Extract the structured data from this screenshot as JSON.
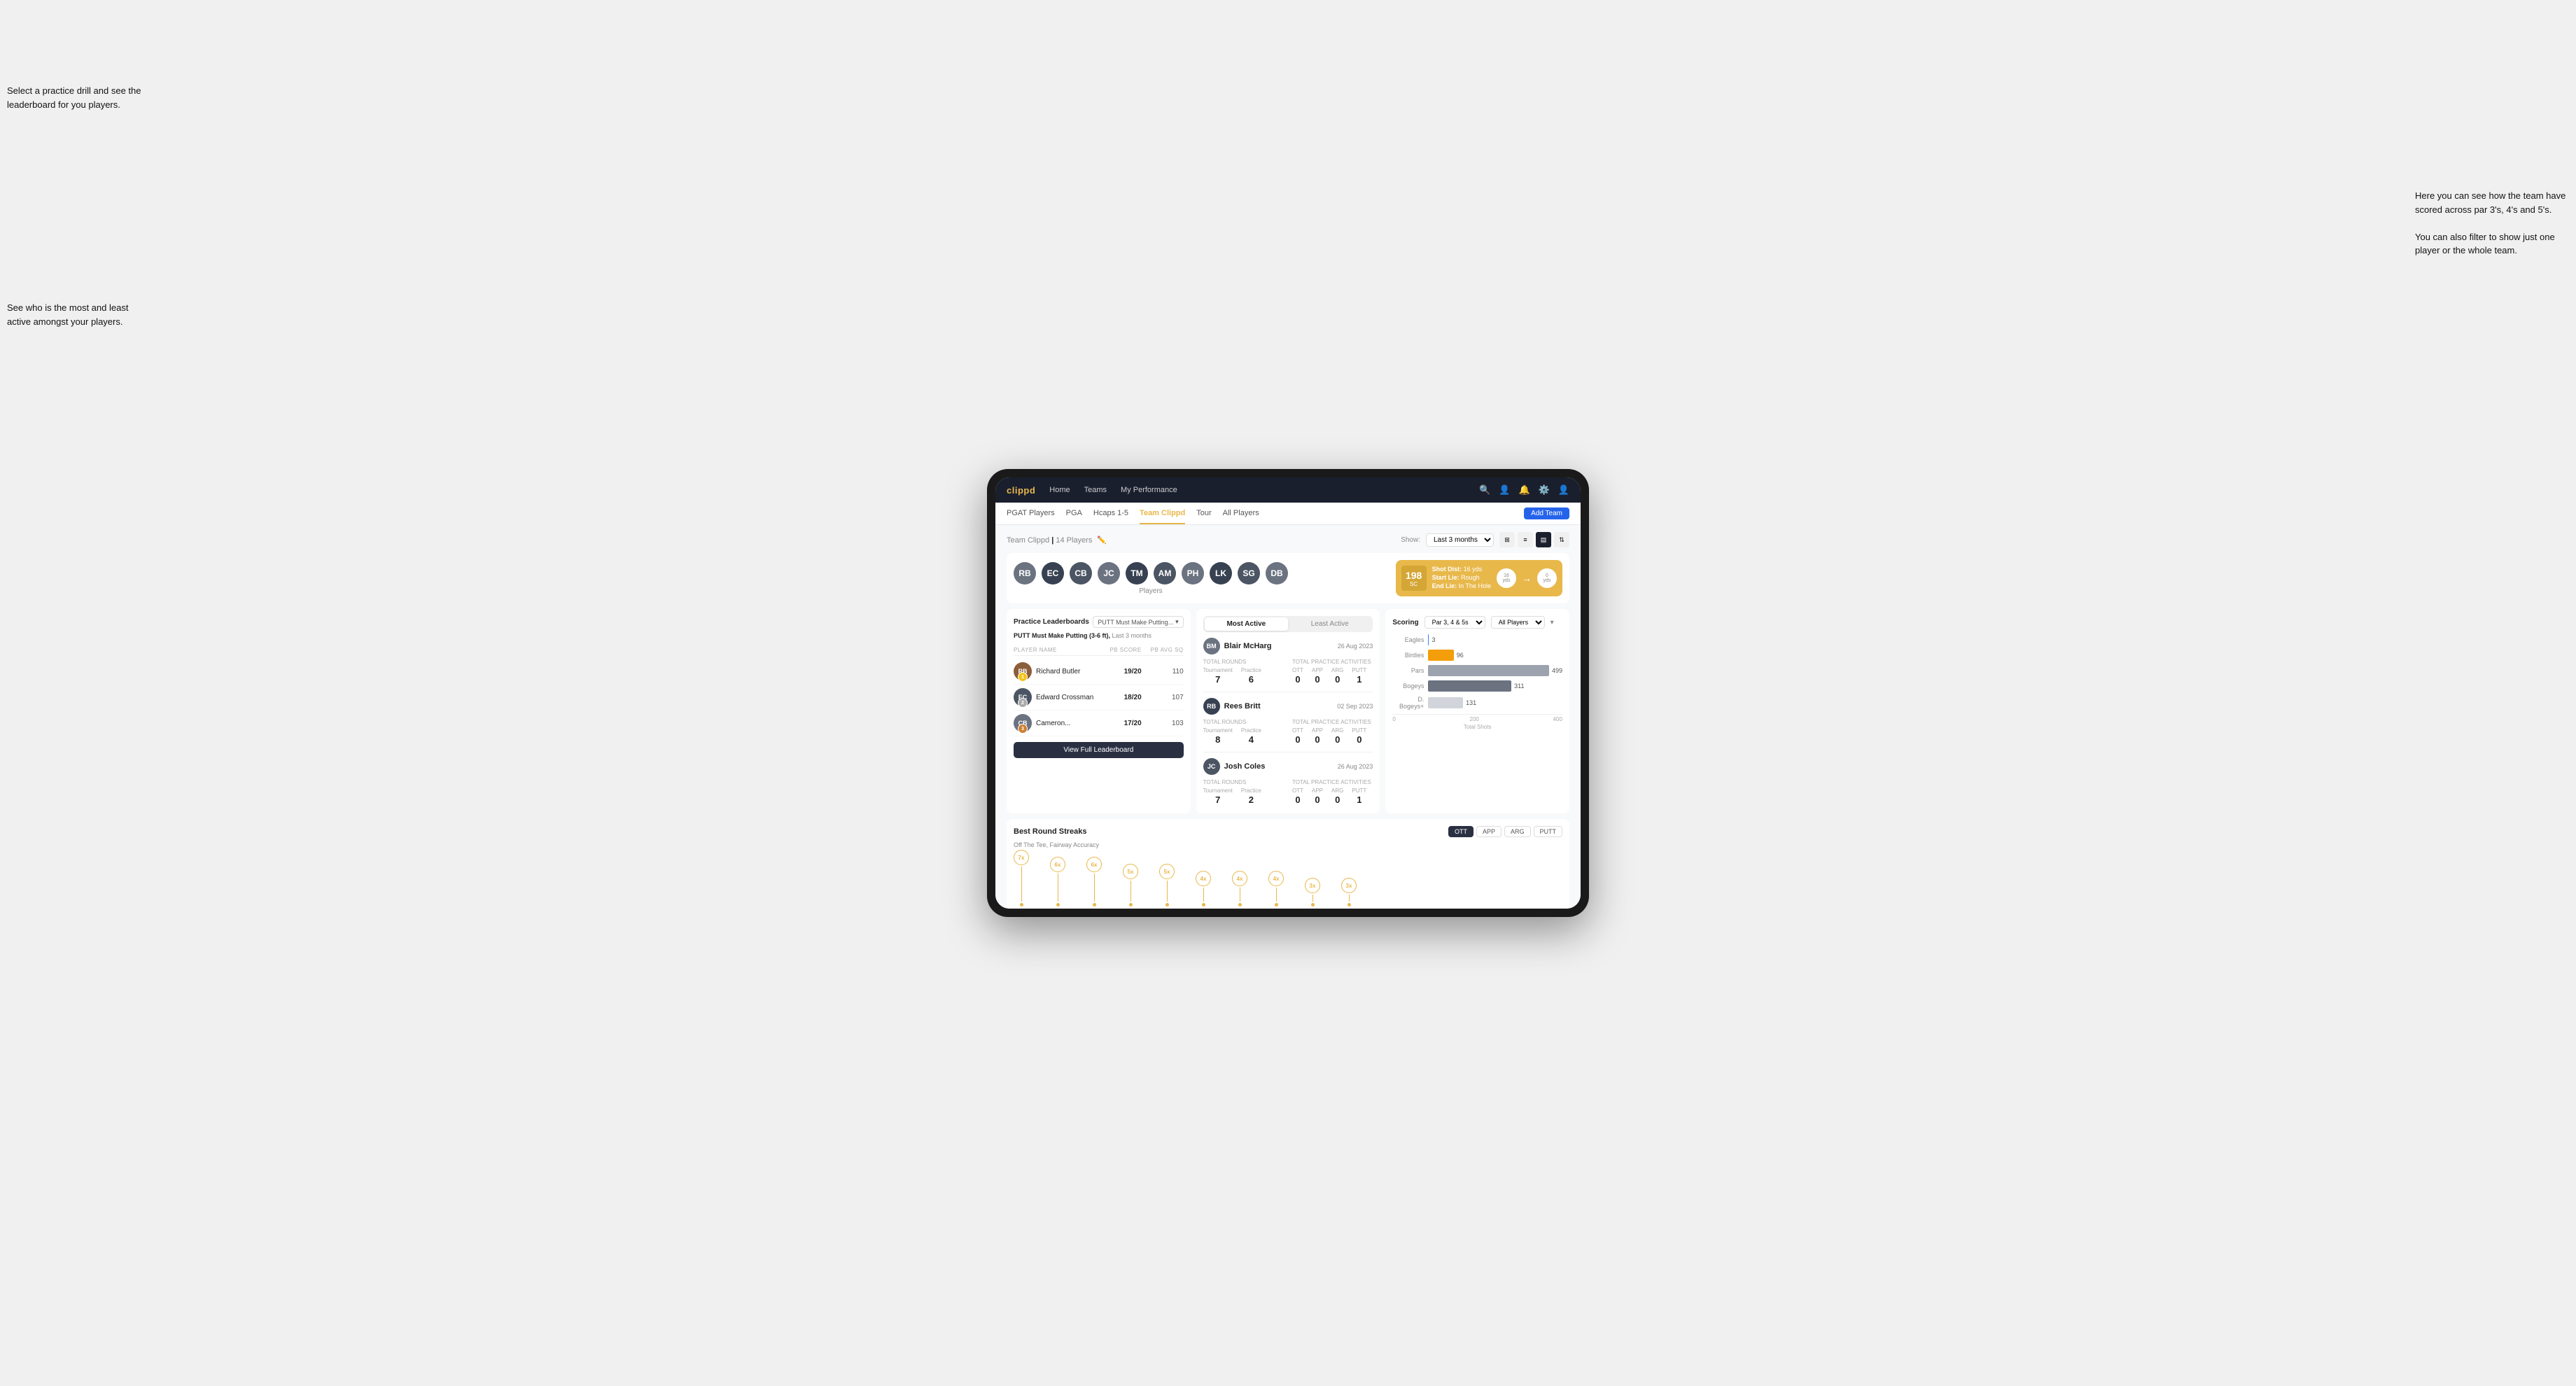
{
  "annotations": {
    "top_left": "Select a practice drill and see the leaderboard for you players.",
    "left_mid": "See who is the most and least active amongst your players.",
    "right": "Here you can see how the team have scored across par 3's, 4's and 5's.\n\nYou can also filter to show just one player or the whole team."
  },
  "navbar": {
    "logo": "clippd",
    "links": [
      "Home",
      "Teams",
      "My Performance"
    ],
    "icons": [
      "search",
      "people",
      "bell",
      "settings",
      "profile"
    ]
  },
  "sub_navbar": {
    "tabs": [
      "PGAT Players",
      "PGA",
      "Hcaps 1-5",
      "Team Clippd",
      "Tour",
      "All Players"
    ],
    "active_tab": "Team Clippd",
    "add_team_label": "Add Team"
  },
  "team_header": {
    "title": "Team Clippd",
    "count": "14 Players",
    "show_label": "Show:",
    "show_value": "Last 3 months",
    "all_players_filter": "All Players"
  },
  "players": [
    {
      "initials": "RB",
      "color": "#6b7280"
    },
    {
      "initials": "EC",
      "color": "#374151"
    },
    {
      "initials": "CB",
      "color": "#4b5563"
    },
    {
      "initials": "JC",
      "color": "#6b7280"
    },
    {
      "initials": "TM",
      "color": "#374151"
    },
    {
      "initials": "AM",
      "color": "#4b5563"
    },
    {
      "initials": "PH",
      "color": "#6b7280"
    },
    {
      "initials": "LK",
      "color": "#374151"
    },
    {
      "initials": "SG",
      "color": "#4b5563"
    },
    {
      "initials": "DB",
      "color": "#6b7280"
    }
  ],
  "players_label": "Players",
  "shot_info": {
    "badge_number": "198",
    "badge_unit": "SC",
    "shot_dist_label": "Shot Dist:",
    "shot_dist_val": "16 yds",
    "start_lie_label": "Start Lie:",
    "start_lie_val": "Rough",
    "end_lie_label": "End Lie:",
    "end_lie_val": "In The Hole",
    "circle1_val": "16",
    "circle1_unit": "yds",
    "circle2_val": "0",
    "circle2_unit": "yds"
  },
  "practice_leaderboard": {
    "title": "Practice Leaderboards",
    "dropdown_label": "PUTT Must Make Putting...",
    "subtitle_drill": "PUTT Must Make Putting (3-6 ft),",
    "subtitle_period": "Last 3 months",
    "col_player": "PLAYER NAME",
    "col_score": "PB SCORE",
    "col_avg": "PB AVG SQ",
    "players": [
      {
        "name": "Richard Butler",
        "score": "19/20",
        "avg": "110",
        "rank": 1,
        "color": "#8b5e3c"
      },
      {
        "name": "Edward Crossman",
        "score": "18/20",
        "avg": "107",
        "rank": 2,
        "color": "#4b5563"
      },
      {
        "name": "Cameron...",
        "score": "17/20",
        "avg": "103",
        "rank": 3,
        "color": "#6b7280"
      }
    ],
    "view_full_label": "View Full Leaderboard"
  },
  "activity": {
    "tabs": [
      "Most Active",
      "Least Active"
    ],
    "active_tab": "Most Active",
    "players": [
      {
        "name": "Blair McHarg",
        "date": "26 Aug 2023",
        "color": "#6b7280",
        "total_rounds_label": "Total Rounds",
        "tournament_label": "Tournament",
        "practice_label": "Practice",
        "tournament_val": "7",
        "practice_val": "6",
        "total_practice_label": "Total Practice Activities",
        "ott_label": "OTT",
        "app_label": "APP",
        "arg_label": "ARG",
        "putt_label": "PUTT",
        "ott_val": "0",
        "app_val": "0",
        "arg_val": "0",
        "putt_val": "1"
      },
      {
        "name": "Rees Britt",
        "date": "02 Sep 2023",
        "color": "#374151",
        "total_rounds_label": "Total Rounds",
        "tournament_label": "Tournament",
        "practice_label": "Practice",
        "tournament_val": "8",
        "practice_val": "4",
        "total_practice_label": "Total Practice Activities",
        "ott_label": "OTT",
        "app_label": "APP",
        "arg_label": "ARG",
        "putt_label": "PUTT",
        "ott_val": "0",
        "app_val": "0",
        "arg_val": "0",
        "putt_val": "0"
      },
      {
        "name": "Josh Coles",
        "date": "26 Aug 2023",
        "color": "#4b5563",
        "total_rounds_label": "Total Rounds",
        "tournament_label": "Tournament",
        "practice_label": "Practice",
        "tournament_val": "7",
        "practice_val": "2",
        "total_practice_label": "Total Practice Activities",
        "ott_label": "OTT",
        "app_label": "APP",
        "arg_label": "ARG",
        "putt_label": "PUTT",
        "ott_val": "0",
        "app_val": "0",
        "arg_val": "0",
        "putt_val": "1"
      }
    ]
  },
  "scoring": {
    "title": "Scoring",
    "filter1_label": "Par 3, 4 & 5s",
    "filter2_label": "All Players",
    "bars": [
      {
        "label": "Eagles",
        "value": 3,
        "max": 500,
        "type": "eagles"
      },
      {
        "label": "Birdies",
        "value": 96,
        "max": 500,
        "type": "birdies"
      },
      {
        "label": "Pars",
        "value": 499,
        "max": 500,
        "type": "pars"
      },
      {
        "label": "Bogeys",
        "value": 311,
        "max": 500,
        "type": "bogeys"
      },
      {
        "label": "D. Bogeys+",
        "value": 131,
        "max": 500,
        "type": "dbogeys"
      }
    ],
    "axis_labels": [
      "0",
      "200",
      "400"
    ],
    "axis_title": "Total Shots"
  },
  "streaks": {
    "title": "Best Round Streaks",
    "tabs": [
      "OTT",
      "APP",
      "ARG",
      "PUTT"
    ],
    "active_tab": "OTT",
    "subtitle": "Off The Tee, Fairway Accuracy",
    "points": [
      {
        "label": "7x",
        "height": 60
      },
      {
        "label": "6x",
        "height": 50
      },
      {
        "label": "6x",
        "height": 50
      },
      {
        "label": "5x",
        "height": 40
      },
      {
        "label": "5x",
        "height": 40
      },
      {
        "label": "4x",
        "height": 30
      },
      {
        "label": "4x",
        "height": 30
      },
      {
        "label": "4x",
        "height": 30
      },
      {
        "label": "3x",
        "height": 20
      },
      {
        "label": "3x",
        "height": 20
      }
    ]
  }
}
